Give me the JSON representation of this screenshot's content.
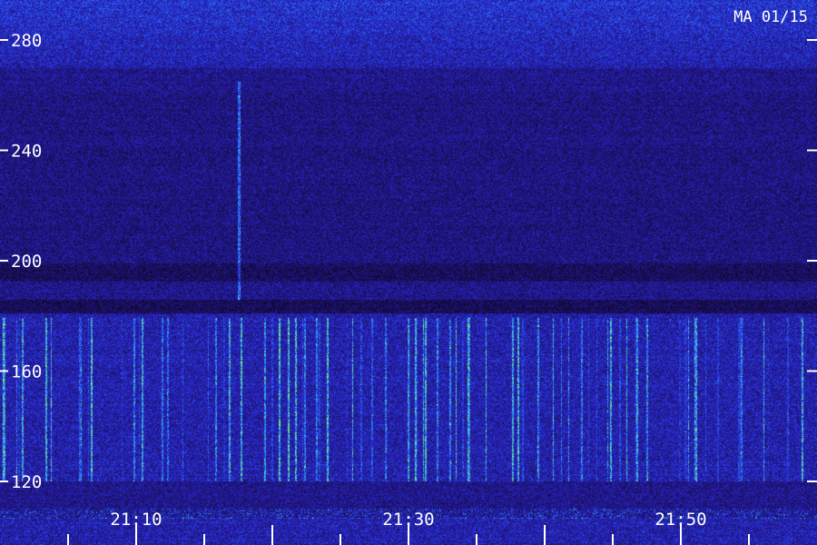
{
  "chart_data": {
    "type": "heatmap",
    "label_top_right": "MA 01/15",
    "y_ticks": [
      {
        "value": 280,
        "label": "280"
      },
      {
        "value": 240,
        "label": "240"
      },
      {
        "value": 200,
        "label": "200"
      },
      {
        "value": 160,
        "label": "160"
      },
      {
        "value": 120,
        "label": "120"
      }
    ],
    "x_labels": [
      {
        "value": 10,
        "label": "21:10"
      },
      {
        "value": 30,
        "label": "21:30"
      },
      {
        "value": 50,
        "label": "21:50"
      }
    ],
    "x_minor_ticks": [
      5,
      10,
      15,
      20,
      25,
      30,
      35,
      40,
      45,
      50,
      55
    ],
    "ylim": [
      113,
      285
    ],
    "xlim": [
      5,
      55
    ],
    "colors": {
      "low": "#0e0730",
      "mid": "#2a2ad0",
      "high": "#2fa8ff",
      "peak": "#7dff6a"
    }
  }
}
